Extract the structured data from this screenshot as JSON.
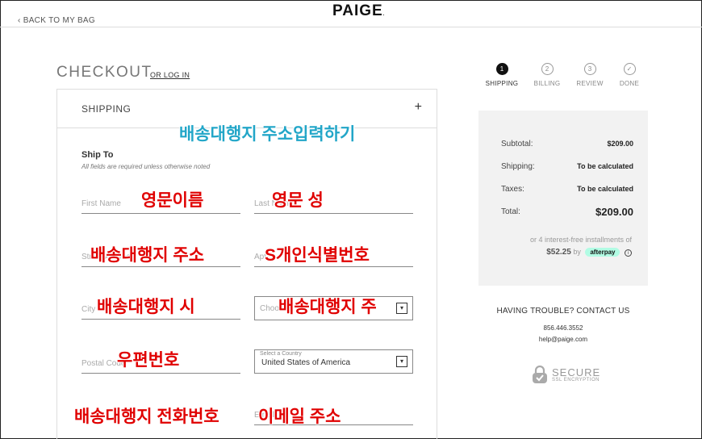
{
  "header": {
    "back_label": "BACK TO MY BAG",
    "back_chevron": "‹",
    "logo": "PAIGE",
    "logo_mark": "."
  },
  "checkout": {
    "title": "CHECKOUT",
    "login_link": "OR LOG IN"
  },
  "shipping_section": {
    "heading": "SHIPPING",
    "expand_icon": "+",
    "ship_to": "Ship To",
    "required_note": "All fields are required unless otherwise noted"
  },
  "form": {
    "first_name_ph": "First Name",
    "last_name_ph": "Last Name",
    "street_ph": "Street Address",
    "apt_ph": "Apt",
    "city_ph": "City",
    "state_ph": "Choose",
    "postal_ph": "Postal Code",
    "country_label": "Select a Country",
    "country_value": "United States of America",
    "email_ph": "Email",
    "select_caret": "▾"
  },
  "annotations": {
    "address_entry": "배송대행지 주소입력하기",
    "first_name": "영문이름",
    "last_name": "영문 성",
    "street": "배송대행지 주소",
    "apt": "S개인식별번호",
    "city": "배송대행지 시",
    "state": "배송대행지 주",
    "postal": "우편번호",
    "phone": "배송대행지 전화번호",
    "email": "이메일 주소",
    "red_color": "#e00000",
    "blue_color": "#22a6c8"
  },
  "steps": [
    {
      "number": "1",
      "label": "SHIPPING",
      "active": true
    },
    {
      "number": "2",
      "label": "BILLING",
      "active": false
    },
    {
      "number": "3",
      "label": "REVIEW",
      "active": false
    },
    {
      "number": "✓",
      "label": "DONE",
      "active": false
    }
  ],
  "summary": {
    "subtotal_label": "Subtotal:",
    "subtotal_value": "$209.00",
    "shipping_label": "Shipping:",
    "shipping_value": "To be calculated",
    "taxes_label": "Taxes:",
    "taxes_value": "To be calculated",
    "total_label": "Total:",
    "total_value": "$209.00",
    "installment_text": "or 4 interest-free installments of",
    "installment_amount": "$52.25",
    "installment_by": "by",
    "afterpay_label": "afterpay",
    "info_icon": "i"
  },
  "help": {
    "title": "HAVING TROUBLE? CONTACT US",
    "phone": "856.446.3552",
    "email": "help@paige.com"
  },
  "secure": {
    "title": "SECURE",
    "subtitle": "SSL ENCRYPTION"
  }
}
